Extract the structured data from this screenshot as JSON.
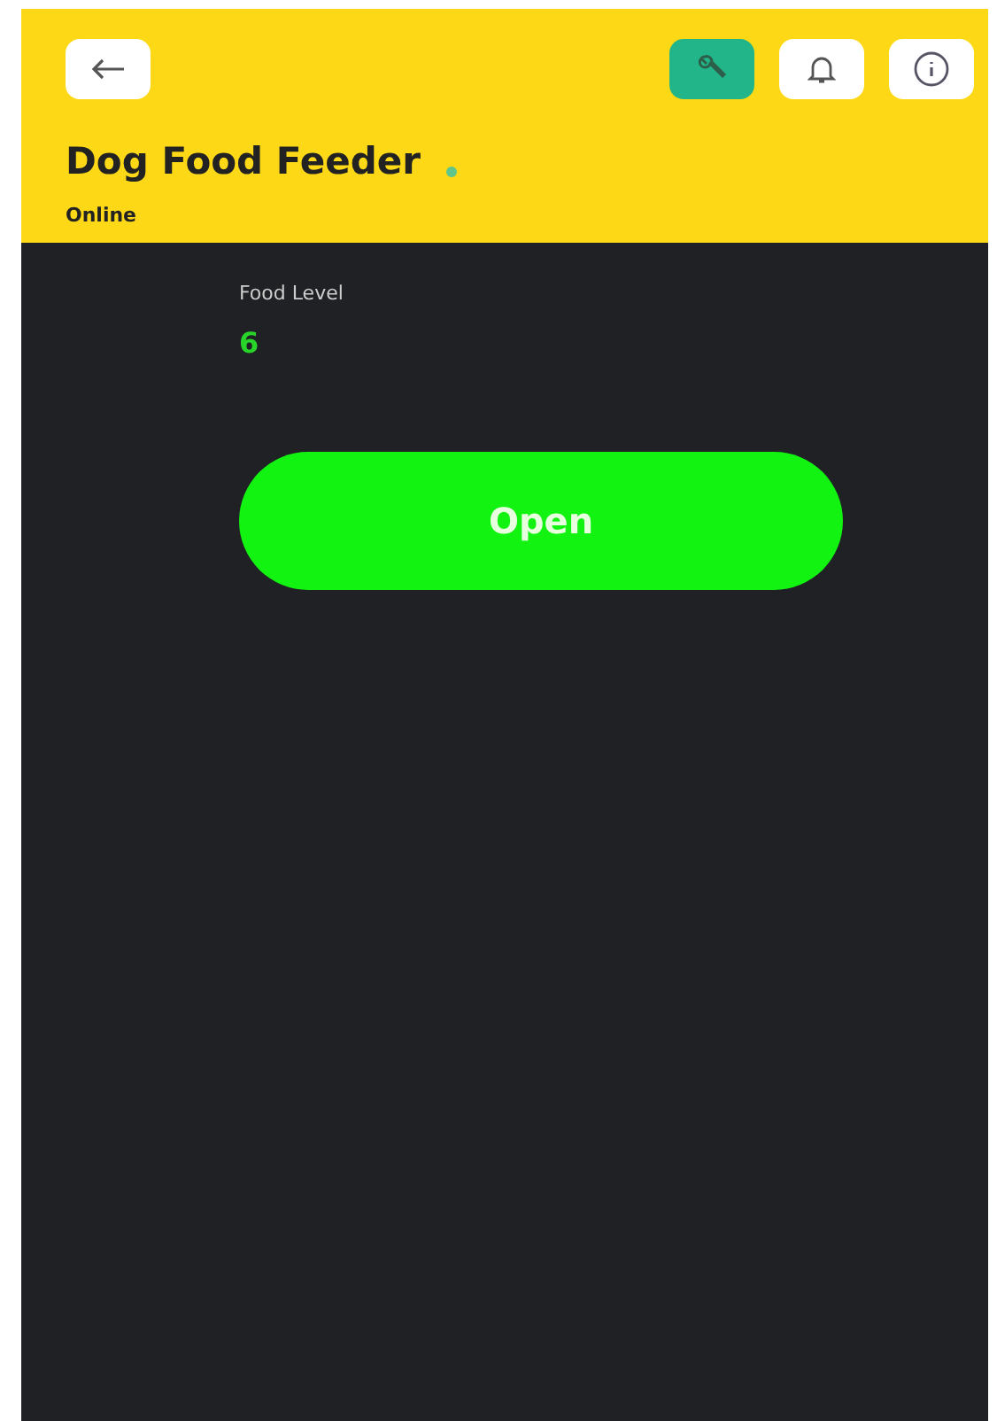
{
  "header": {
    "title": "Dog Food Feeder",
    "status": "Online",
    "toolbar": [
      {
        "kind": "wrench",
        "selected": true
      },
      {
        "kind": "bell",
        "selected": false
      },
      {
        "kind": "info",
        "selected": false
      }
    ]
  },
  "widgets": [
    {
      "kind": "value",
      "label": "Food Level",
      "value": "6"
    },
    {
      "kind": "button",
      "label": "Open"
    }
  ]
}
